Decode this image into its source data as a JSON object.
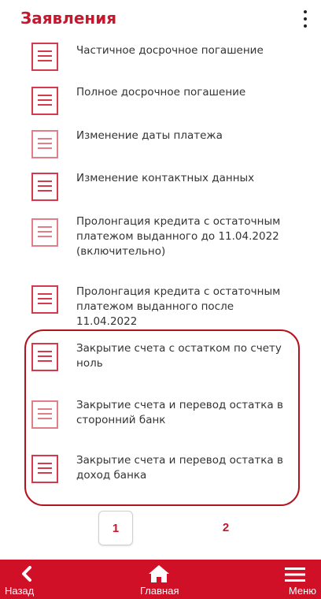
{
  "header": {
    "title": "Заявления",
    "menu_icon": "more-vertical-icon"
  },
  "applications": [
    {
      "label": "Частичное досрочное погашение",
      "icon": "document-icon"
    },
    {
      "label": "Полное досрочное погашение",
      "icon": "document-icon"
    },
    {
      "label": "Изменение даты платежа",
      "icon": "document-icon"
    },
    {
      "label": "Изменение контактных данных",
      "icon": "document-icon"
    },
    {
      "label": "Пролонгация кредита с остаточным платежом выданного до 11.04.2022 (включительно)",
      "icon": "document-icon"
    },
    {
      "label": "Пролонгация кредита с остаточным платежом выданного после 11.04.2022",
      "icon": "document-icon"
    },
    {
      "label": "Закрытие счета с остатком по счету ноль",
      "icon": "document-icon"
    },
    {
      "label": "Закрытие счета и перевод остатка в сторонний банк",
      "icon": "document-icon"
    },
    {
      "label": "Закрытие счета и перевод остатка в доход банка",
      "icon": "document-icon"
    }
  ],
  "pagination": {
    "pages": [
      "1",
      "2"
    ],
    "current": "1"
  },
  "bottom_nav": {
    "back_label": "Назад",
    "home_label": "Главная",
    "menu_label": "Меню"
  },
  "colors": {
    "brand_red": "#d01026",
    "title_red": "#c6172e",
    "highlight": "#b3121f"
  }
}
